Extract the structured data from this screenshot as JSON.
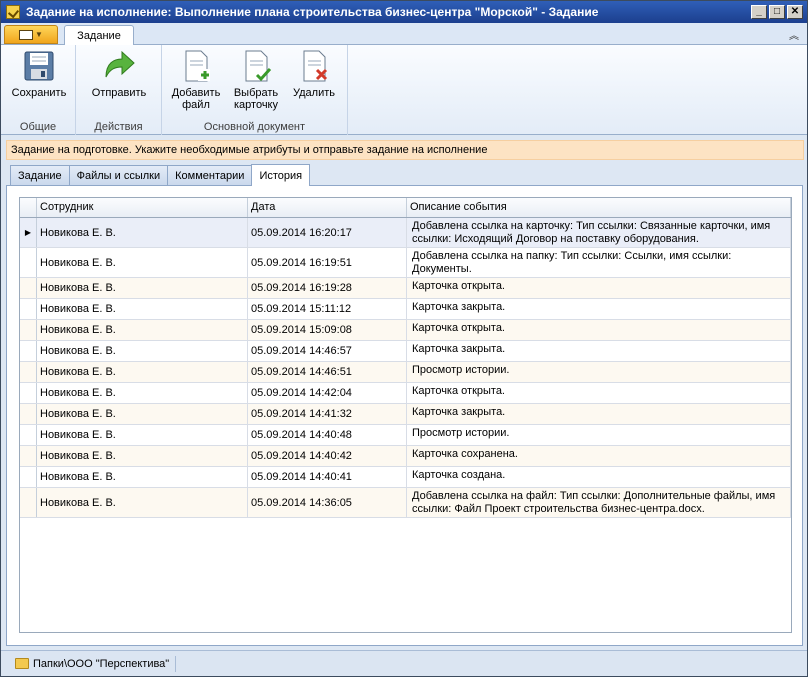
{
  "window": {
    "title": "Задание на исполнение: Выполнение плана строительства бизнес-центра \"Морской\" - Задание"
  },
  "ribbon": {
    "tab": "Задание",
    "groups": [
      {
        "label": "Общие",
        "buttons": [
          {
            "label": "Сохранить",
            "icon": "save-icon"
          }
        ]
      },
      {
        "label": "Действия",
        "buttons": [
          {
            "label": "Отправить",
            "icon": "send-arrow-icon"
          }
        ]
      },
      {
        "label": "Основной документ",
        "buttons": [
          {
            "line1": "Добавить",
            "line2": "файл",
            "icon": "add-file-icon"
          },
          {
            "line1": "Выбрать",
            "line2": "карточку",
            "icon": "select-card-icon"
          },
          {
            "line1": "Удалить",
            "line2": "",
            "icon": "delete-icon"
          }
        ]
      }
    ]
  },
  "notice": "Задание на подготовке. Укажите необходимые атрибуты и отправьте задание на исполнение",
  "tabs": [
    "Задание",
    "Файлы и ссылки",
    "Комментарии",
    "История"
  ],
  "grid": {
    "columns": [
      "Сотрудник",
      "Дата",
      "Описание события"
    ],
    "rows": [
      {
        "employee": "Новикова Е. В.",
        "date": "05.09.2014 16:20:17",
        "desc": "Добавлена ссылка на карточку: Тип ссылки: Связанные карточки, имя ссылки: Исходящий Договор на поставку оборудования."
      },
      {
        "employee": "Новикова Е. В.",
        "date": "05.09.2014 16:19:51",
        "desc": "Добавлена ссылка на папку: Тип ссылки: Ссылки, имя ссылки: Документы."
      },
      {
        "employee": "Новикова Е. В.",
        "date": "05.09.2014 16:19:28",
        "desc": "Карточка открыта."
      },
      {
        "employee": "Новикова Е. В.",
        "date": "05.09.2014 15:11:12",
        "desc": "Карточка закрыта."
      },
      {
        "employee": "Новикова Е. В.",
        "date": "05.09.2014 15:09:08",
        "desc": "Карточка открыта."
      },
      {
        "employee": "Новикова Е. В.",
        "date": "05.09.2014 14:46:57",
        "desc": "Карточка закрыта."
      },
      {
        "employee": "Новикова Е. В.",
        "date": "05.09.2014 14:46:51",
        "desc": "Просмотр истории."
      },
      {
        "employee": "Новикова Е. В.",
        "date": "05.09.2014 14:42:04",
        "desc": "Карточка открыта."
      },
      {
        "employee": "Новикова Е. В.",
        "date": "05.09.2014 14:41:32",
        "desc": "Карточка закрыта."
      },
      {
        "employee": "Новикова Е. В.",
        "date": "05.09.2014 14:40:48",
        "desc": "Просмотр истории."
      },
      {
        "employee": "Новикова Е. В.",
        "date": "05.09.2014 14:40:42",
        "desc": "Карточка сохранена."
      },
      {
        "employee": "Новикова Е. В.",
        "date": "05.09.2014 14:40:41",
        "desc": "Карточка создана."
      },
      {
        "employee": "Новикова Е. В.",
        "date": "05.09.2014 14:36:05",
        "desc": "Добавлена ссылка на файл: Тип ссылки: Дополнительные файлы, имя ссылки: Файл Проект строительства бизнес-центра.docx."
      }
    ]
  },
  "statusbar": {
    "path": "Папки\\ООО \"Перспектива\""
  }
}
